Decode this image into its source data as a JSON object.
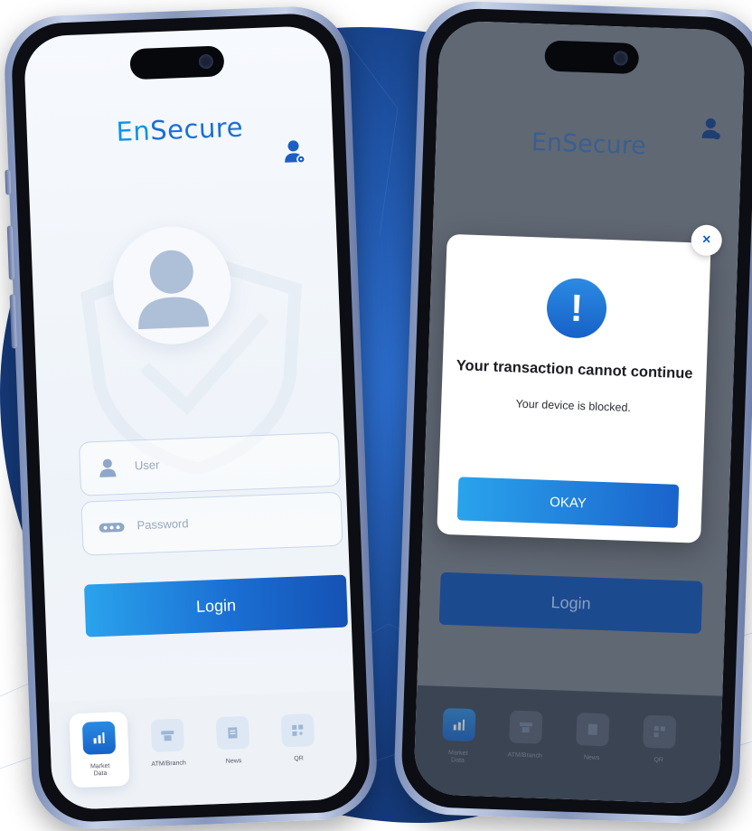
{
  "brand": {
    "logo_prefix": "En",
    "logo_suffix": "Secure"
  },
  "login_screen": {
    "user_placeholder": "User",
    "password_placeholder": "Password",
    "login_label": "Login"
  },
  "tabbar": {
    "items": [
      {
        "label": "Market\nData",
        "icon": "chart-icon",
        "active": true
      },
      {
        "label": "ATM/Branch",
        "icon": "atm-icon",
        "active": false
      },
      {
        "label": "News",
        "icon": "news-icon",
        "active": false
      },
      {
        "label": "QR",
        "icon": "qr-icon",
        "active": false
      }
    ]
  },
  "alert": {
    "title": "Your transaction cannot continue",
    "message": "Your device is blocked.",
    "okay_label": "OKAY",
    "close_symbol": "×",
    "alert_symbol": "!"
  },
  "colors": {
    "brand_blue": "#1a6fd8",
    "accent_cyan": "#2aa3ec",
    "dark_overlay": "#37404e"
  }
}
